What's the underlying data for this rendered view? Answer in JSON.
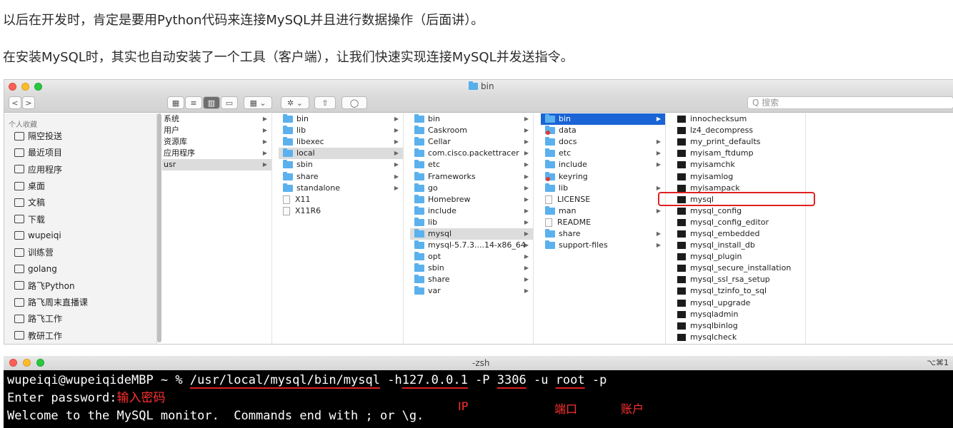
{
  "paragraphs": {
    "p1": "以后在开发时，肯定是要用Python代码来连接MySQL并且进行数据操作（后面讲）。",
    "p2": "在安装MySQL时，其实也自动安装了一个工具（客户端），让我们快速实现连接MySQL并发送指令。"
  },
  "finder": {
    "title": "bin",
    "search_placeholder": "Q 搜索",
    "toolbar": {
      "back": "<",
      "forward": ">",
      "view_icons": "▦",
      "view_list": "≡",
      "view_columns": "▥",
      "view_gallery": "▭",
      "group": "▦ ⌄",
      "action": "✲ ⌄",
      "share": "⇧",
      "tag": "◯"
    },
    "sidebar": {
      "header": "个人收藏",
      "items": [
        {
          "icon": "airdrop-icon",
          "label": "隔空投送"
        },
        {
          "icon": "recents-icon",
          "label": "最近项目"
        },
        {
          "icon": "applications-icon",
          "label": "应用程序"
        },
        {
          "icon": "desktop-icon",
          "label": "桌面"
        },
        {
          "icon": "documents-icon",
          "label": "文稿"
        },
        {
          "icon": "downloads-icon",
          "label": "下载"
        },
        {
          "icon": "home-icon",
          "label": "wupeiqi"
        },
        {
          "icon": "folder-icon",
          "label": "训练营"
        },
        {
          "icon": "folder-icon",
          "label": "golang"
        },
        {
          "icon": "folder-icon",
          "label": "路飞Python"
        },
        {
          "icon": "folder-icon",
          "label": "路飞周末直播课"
        },
        {
          "icon": "folder-icon",
          "label": "路飞工作"
        },
        {
          "icon": "folder-icon",
          "label": "教研工作"
        }
      ]
    },
    "col1": [
      "系统",
      "用户",
      "资源库",
      "应用程序",
      "usr"
    ],
    "col2": [
      "bin",
      "lib",
      "libexec",
      "local",
      "sbin",
      "share",
      "standalone",
      "X11",
      "X11R6"
    ],
    "col3": [
      "bin",
      "Caskroom",
      "Cellar",
      "com.cisco.packettracer",
      "etc",
      "Frameworks",
      "go",
      "Homebrew",
      "include",
      "lib",
      "mysql",
      "mysql-5.7.3....14-x86_64",
      "opt",
      "sbin",
      "share",
      "var"
    ],
    "col4": [
      "bin",
      "data",
      "docs",
      "etc",
      "include",
      "keyring",
      "lib",
      "LICENSE",
      "man",
      "README",
      "share",
      "support-files"
    ],
    "col5": [
      "innochecksum",
      "lz4_decompress",
      "my_print_defaults",
      "myisam_ftdump",
      "myisamchk",
      "myisamlog",
      "myisampack",
      "mysql",
      "mysql_config",
      "mysql_config_editor",
      "mysql_embedded",
      "mysql_install_db",
      "mysql_plugin",
      "mysql_secure_installation",
      "mysql_ssl_rsa_setup",
      "mysql_tzinfo_to_sql",
      "mysql_upgrade",
      "mysqladmin",
      "mysqlbinlog",
      "mysqlcheck"
    ]
  },
  "terminal": {
    "title": "-zsh",
    "shortcut": "⌥⌘1",
    "prompt": "wupeiqi@wupeiqideMBP ~ % ",
    "cmd_path": "/usr/local/mysql/bin/mysql",
    "opt_h": " -h",
    "ip": "127.0.0.1",
    "opt_P": " -P ",
    "port": "3306",
    "opt_u": " -u ",
    "user": "root",
    "opt_p": " -p",
    "line2": "Enter password:",
    "line2_note": "输入密码",
    "line3": "Welcome to the MySQL monitor.  Commands end with ; or \\g.",
    "ann_ip": "IP",
    "ann_port": "端口",
    "ann_user": "账户"
  }
}
